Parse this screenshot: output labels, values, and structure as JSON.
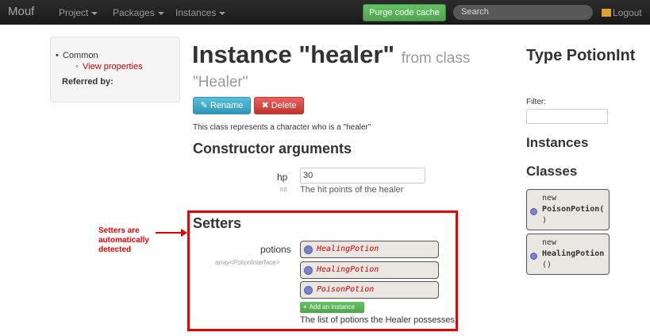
{
  "navbar": {
    "brand": "Mouf",
    "menus": [
      {
        "label": "Project"
      },
      {
        "label": "Packages"
      },
      {
        "label": "Instances"
      }
    ],
    "purge_label": "Purge code cache",
    "search_placeholder": "Search",
    "logout_label": "Logout"
  },
  "sidebar": {
    "common": "Common",
    "view_properties": "View properties",
    "referred_by": "Referred by:"
  },
  "main": {
    "title": "Instance \"healer\"",
    "title_from": "from class",
    "class_name": "\"Healer\"",
    "rename_label": "Rename",
    "delete_label": "Delete",
    "description": "This class represents a character who is a \"healer\"",
    "constructor_heading": "Constructor arguments",
    "hp": {
      "label": "hp",
      "type": "int",
      "value": "30",
      "description": "The hit points of the healer"
    },
    "setters_heading": "Setters",
    "potions": {
      "label": "potions",
      "type": "array<PotionInterface>",
      "items": [
        "HealingPotion",
        "HealingPotion",
        "PoisonPotion"
      ],
      "add_label": "Add an instance",
      "description": "The list of potions the Healer possesses."
    }
  },
  "annotation": {
    "text": "Setters are automatically detected",
    "color": "#e00000"
  },
  "right_panel": {
    "type_heading": "Type PotionInt",
    "filter_label": "Filter:",
    "instances_heading": "Instances",
    "classes_heading": "Classes",
    "classes": [
      {
        "prefix": "new",
        "name": "PoisonPotion(",
        "suffix": ")"
      },
      {
        "prefix": "new",
        "name": "HealingPotion",
        "suffix": "()"
      }
    ]
  }
}
